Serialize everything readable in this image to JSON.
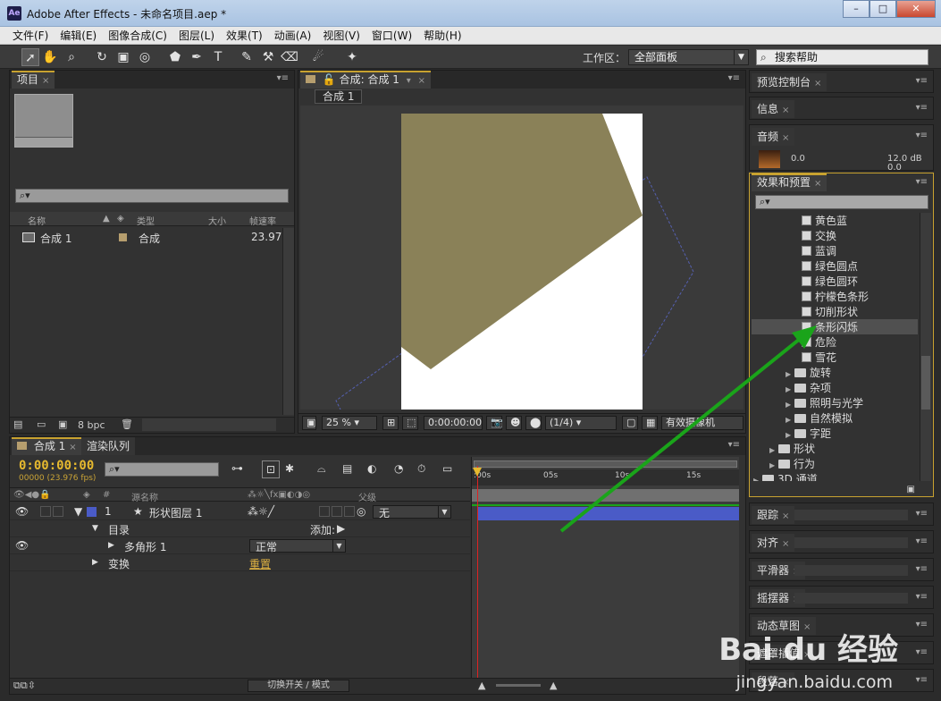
{
  "window": {
    "title": "Adobe After Effects - 未命名项目.aep *",
    "app_icon": "Ae",
    "minimize": "–",
    "maximize": "□",
    "close": "✕"
  },
  "menu": [
    "文件(F)",
    "编辑(E)",
    "图像合成(C)",
    "图层(L)",
    "效果(T)",
    "动画(A)",
    "视图(V)",
    "窗口(W)",
    "帮助(H)"
  ],
  "toolbar": {
    "workspace_label": "工作区：",
    "workspace_value": "全部面板",
    "search_help": "搜索帮助",
    "text_tool": "T"
  },
  "project": {
    "tab": "项目",
    "columns": [
      "名称",
      "类型",
      "大小",
      "帧速率"
    ],
    "items": [
      {
        "name": "合成 1",
        "type": "合成",
        "fps": "23.976"
      }
    ],
    "bpc": "8 bpc"
  },
  "comp_viewer": {
    "tab": "合成: 合成 1",
    "sub_tab": "合成 1",
    "zoom": "25 %",
    "timecode": "0:00:00:00",
    "resolution": "(1/4)",
    "camera": "有效摄像机",
    "colors": {
      "shape_fill": "#8a8158",
      "canvas": "#ffffff",
      "board": "#3a3a3a"
    }
  },
  "timeline": {
    "tabs": [
      "合成 1",
      "渲染队列"
    ],
    "time": "0:00:00:00",
    "fps": "00000 (23.976 fps)",
    "columns": {
      "num": "#",
      "source": "源名称",
      "parent": "父级"
    },
    "ruler": [
      ":00s",
      "05s",
      "10s",
      "15s"
    ],
    "layer": {
      "num": "1",
      "name": "形状图层 1",
      "parent": "无"
    },
    "contents": "目录",
    "add": "添加:",
    "polygon": "多角形 1",
    "blend": "正常",
    "transform": "变换",
    "reset": "重置",
    "footer": "切换开关 / 模式"
  },
  "right_panels": {
    "preview": "预览控制台",
    "info": "信息",
    "audio": "音频",
    "audio_vals": [
      "0.0",
      "12.0 dB",
      "0.0"
    ],
    "effects": "效果和预置",
    "tree": [
      {
        "label": "黄色蓝",
        "kind": "fx",
        "level": 2
      },
      {
        "label": "交换",
        "kind": "fx",
        "level": 2
      },
      {
        "label": "蓝调",
        "kind": "fx",
        "level": 2
      },
      {
        "label": "绿色圆点",
        "kind": "fx",
        "level": 2
      },
      {
        "label": "绿色圆环",
        "kind": "fx",
        "level": 2
      },
      {
        "label": "柠檬色条形",
        "kind": "fx",
        "level": 2
      },
      {
        "label": "切削形状",
        "kind": "fx",
        "level": 2
      },
      {
        "label": "条形闪烁",
        "kind": "fx",
        "level": 2,
        "highlight": true
      },
      {
        "label": "危险",
        "kind": "fx",
        "level": 2
      },
      {
        "label": "雪花",
        "kind": "fx",
        "level": 2
      },
      {
        "label": "旋转",
        "kind": "folder",
        "level": 1
      },
      {
        "label": "杂项",
        "kind": "folder",
        "level": 1
      },
      {
        "label": "照明与光学",
        "kind": "folder",
        "level": 1
      },
      {
        "label": "自然模拟",
        "kind": "folder",
        "level": 1
      },
      {
        "label": "字距",
        "kind": "folder",
        "level": 1
      },
      {
        "label": "形状",
        "kind": "folder",
        "level": 0
      },
      {
        "label": "行为",
        "kind": "folder",
        "level": 0
      },
      {
        "label": "3D 通道",
        "kind": "folder",
        "level": -1
      }
    ],
    "tracker": "跟踪",
    "align": "对齐",
    "smoother": "平滑器",
    "wiggler": "摇摆器",
    "motion_sketch": "动态草图",
    "mask_interp": "遮罩插值",
    "paragraph": "段落"
  },
  "watermark": {
    "brand": "Bai du 经验",
    "url": "jingyan.baidu.com"
  },
  "accent": {
    "orange": "#e0b341",
    "arrow": "#1aa41a",
    "layer_bar": "#4a5bc7"
  }
}
